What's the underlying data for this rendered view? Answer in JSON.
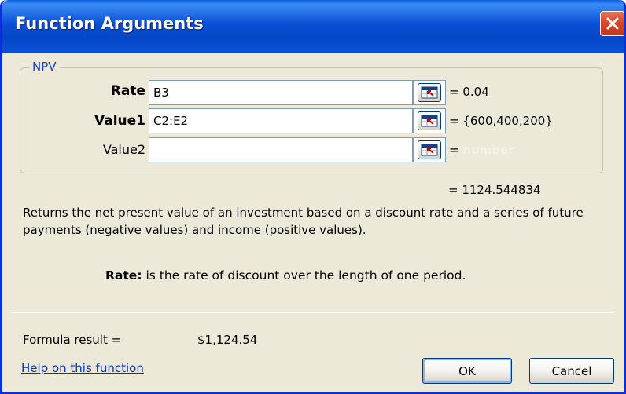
{
  "window": {
    "title": "Function Arguments",
    "close_icon": "close-icon",
    "close_color": "#d9472b"
  },
  "function_group": {
    "name": "NPV",
    "arguments": [
      {
        "label": "Rate",
        "bold": true,
        "value": "B3",
        "result": "= 0.04"
      },
      {
        "label": "Value1",
        "bold": true,
        "value": "C2:E2",
        "result": "= {600,400,200}"
      },
      {
        "label": "Value2",
        "bold": false,
        "value": "",
        "result_prefix": "= ",
        "result_hint": "number"
      }
    ],
    "collapse_icon": "range-collapse-icon"
  },
  "result": {
    "value_line": "= 1124.544834"
  },
  "description": "Returns the net present value of an investment based on a discount rate and a series of future payments (negative values) and income (positive values).",
  "argument_help": {
    "name": "Rate:",
    "text": " is the rate of discount over the length of one period."
  },
  "formula": {
    "label": "Formula result =",
    "value": "$1,124.54"
  },
  "footer": {
    "help_link": "Help on this function",
    "ok_label": "OK",
    "cancel_label": "Cancel"
  },
  "colors": {
    "titlebar": "#0a4fd6",
    "dialog_bg": "#ece9d8",
    "legend": "#1a3fd0",
    "link": "#0033cc"
  }
}
